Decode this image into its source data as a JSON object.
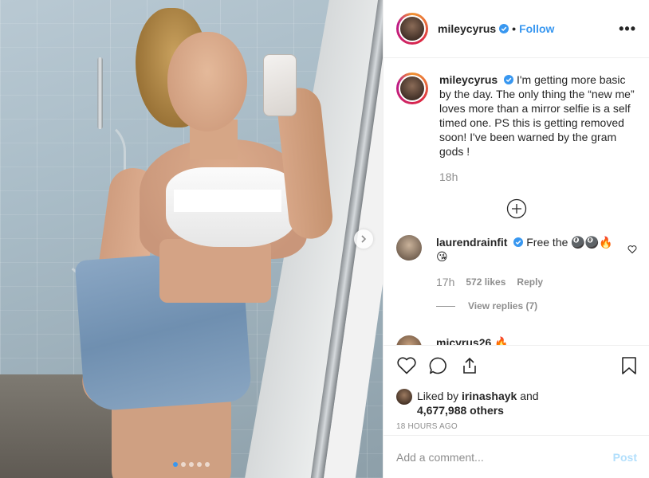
{
  "post": {
    "username": "mileycyrus",
    "follow_label": "Follow",
    "separator": "•",
    "more_label": "•••"
  },
  "caption": {
    "username": "mileycyrus",
    "text": "I'm getting more basic by the day. The only thing the “new me” loves more than a mirror selfie is a self timed one. PS this is getting removed soon! I've been warned by the gram gods !",
    "time": "18h"
  },
  "comments": [
    {
      "username": "laurendrainfit",
      "text": "Free the 🎱🎱🔥 😘",
      "time": "17h",
      "likes": "572 likes",
      "reply_label": "Reply",
      "view_replies": "View replies (7)"
    },
    {
      "username": "micyrus26",
      "text": "🔥"
    }
  ],
  "likes": {
    "prefix": "Liked by",
    "user": "irinashayk",
    "joiner": "and",
    "count": "4,677,988 others"
  },
  "timestamp": "18 HOURS AGO",
  "add_comment": {
    "placeholder": "Add a comment...",
    "post_label": "Post"
  },
  "carousel": {
    "total": 5,
    "active": 1
  },
  "colors": {
    "accent": "#3897f0",
    "verified": "#3897f0",
    "muted": "#8e8e8e"
  }
}
